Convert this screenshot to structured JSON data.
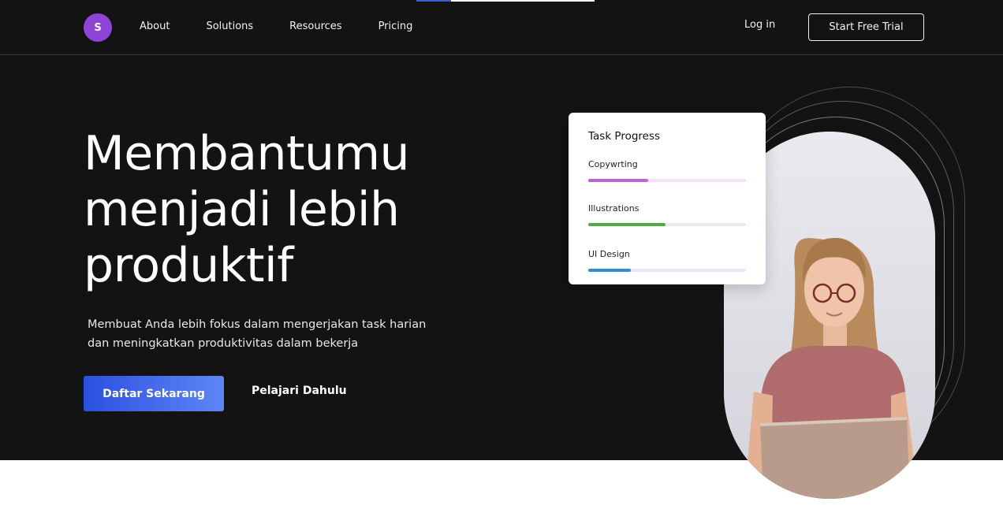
{
  "nav": {
    "logo_letter": "S",
    "links": [
      "About",
      "Solutions",
      "Resources",
      "Pricing"
    ],
    "login": "Log in",
    "trial": "Start Free Trial"
  },
  "hero": {
    "headline": [
      "Membantumu",
      "menjadi lebih",
      "produktif"
    ],
    "subtext": [
      "Membuat Anda lebih fokus dalam mengerjakan task harian",
      "dan meningkatkan produktivitas dalam bekerja"
    ],
    "cta_primary": "Daftar Sekarang",
    "cta_secondary": "Pelajari Dahulu"
  },
  "task_card": {
    "title": "Task Progress",
    "items": [
      {
        "label": "Copywrting",
        "progress": 0.38,
        "color": "#c45ed8",
        "track": "#f3e3f7"
      },
      {
        "label": "Illustrations",
        "progress": 0.49,
        "color": "#4cae3f",
        "track": "#ebebeb"
      },
      {
        "label": "UI Design",
        "progress": 0.27,
        "color": "#2e8fd1",
        "track": "#e9e6f6"
      }
    ]
  },
  "colors": {
    "hero_bg": "#141314",
    "logo": "#8e44d6",
    "cta_gradient": [
      "#2b4fe0",
      "#5f86f5"
    ]
  }
}
